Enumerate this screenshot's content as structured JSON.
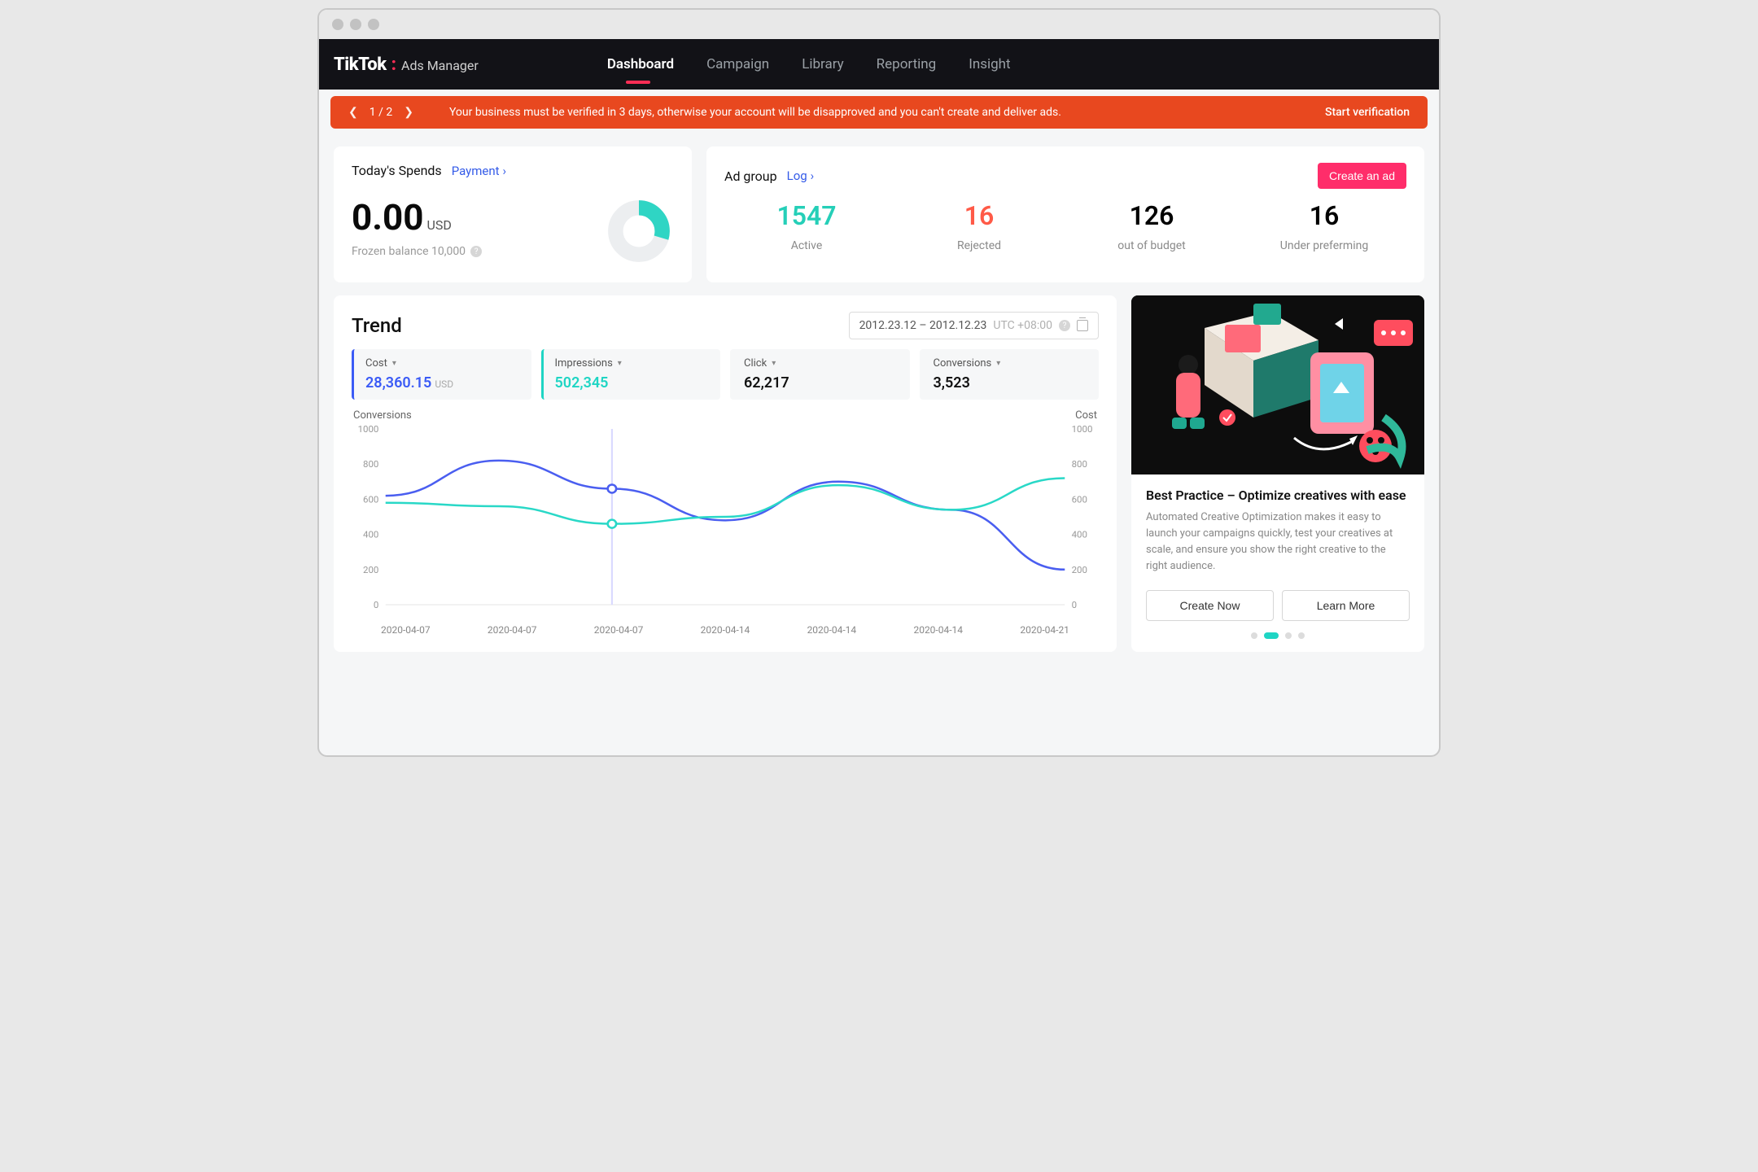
{
  "brand": {
    "name": "TikTok",
    "sub": "Ads Manager"
  },
  "nav": {
    "items": [
      "Dashboard",
      "Campaign",
      "Library",
      "Reporting",
      "Insight"
    ],
    "active": 0
  },
  "alert": {
    "pager": "1  /  2",
    "message": "Your business must be verified in 3 days, otherwise your account will be disapproved and you can't create and deliver ads.",
    "cta": "Start verification"
  },
  "spends": {
    "title": "Today's Spends",
    "payment_link": "Payment",
    "amount": "0.00",
    "currency": "USD",
    "frozen_label": "Frozen balance 10,000",
    "donut_pct": 30
  },
  "adgroup": {
    "title": "Ad group",
    "log_link": "Log",
    "create_button": "Create an ad",
    "stats": [
      {
        "value": "1547",
        "label": "Active",
        "color": "green"
      },
      {
        "value": "16",
        "label": "Rejected",
        "color": "red"
      },
      {
        "value": "126",
        "label": "out of budget",
        "color": ""
      },
      {
        "value": "16",
        "label": "Under preferming",
        "color": ""
      }
    ]
  },
  "trend": {
    "title": "Trend",
    "date_range": "2012.23.12 – 2012.12.23",
    "timezone": "UTC +08:00",
    "metrics": [
      {
        "label": "Cost",
        "value": "28,360.15",
        "suffix": "USD",
        "accent": "blue"
      },
      {
        "label": "Impressions",
        "value": "502,345",
        "accent": "teal"
      },
      {
        "label": "Click",
        "value": "62,217",
        "accent": ""
      },
      {
        "label": "Conversions",
        "value": "3,523",
        "accent": ""
      }
    ],
    "ylabel_left": "Conversions",
    "ylabel_right": "Cost"
  },
  "side": {
    "title": "Best Practice – Optimize creatives with ease",
    "desc": "Automated Creative Optimization makes it easy to launch your campaigns quickly, test your creatives at scale, and ensure you show the right creative to the right audience.",
    "primary": "Create Now",
    "secondary": "Learn More"
  },
  "chart_data": {
    "type": "line",
    "xlabel": "",
    "ylabel_left": "Conversions",
    "ylabel_right": "Cost",
    "ylim": [
      0,
      1000
    ],
    "y_ticks": [
      0,
      200,
      400,
      600,
      800,
      1000
    ],
    "categories": [
      "2020-04-07",
      "2020-04-07",
      "2020-04-07",
      "2020-04-14",
      "2020-04-14",
      "2020-04-14",
      "2020-04-21"
    ],
    "series": [
      {
        "name": "Conversions",
        "color": "#4a5ef0",
        "values": [
          620,
          820,
          660,
          480,
          700,
          540,
          200
        ]
      },
      {
        "name": "Cost",
        "color": "#29d8c7",
        "values": [
          580,
          560,
          460,
          500,
          680,
          540,
          720
        ]
      }
    ],
    "marker_x_index": 2
  }
}
